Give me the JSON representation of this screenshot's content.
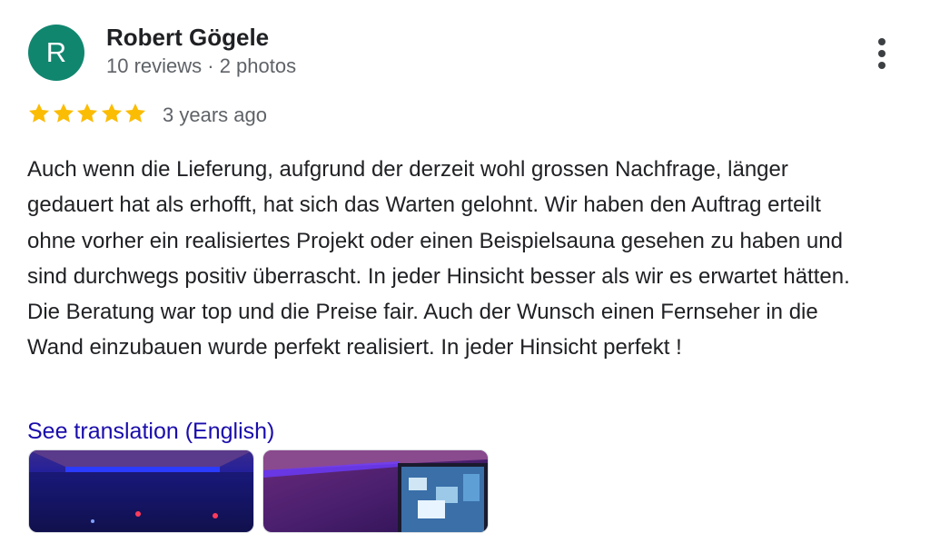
{
  "author": {
    "avatar_letter": "R",
    "avatar_color": "#11866f",
    "name": "Robert Gögele",
    "meta": "10 reviews · 2 photos"
  },
  "menu": {
    "icon": "more-vert-icon"
  },
  "rating": {
    "stars": 5,
    "max_stars": 5,
    "star_color": "#fbbc04",
    "time": "3 years ago"
  },
  "review": {
    "text": "Auch wenn die Lieferung, aufgrund der derzeit wohl grossen Nachfrage, länger gedauert hat als erhofft, hat sich das Warten gelohnt. Wir haben den Auftrag erteilt ohne vorher ein realisiertes Projekt oder einen Beispielsauna gesehen zu haben und sind durchwegs positiv überrascht. In jeder Hinsicht besser als wir es erwartet hätten. Die Beratung war top und die Preise fair. Auch der Wunsch einen Fernseher in die Wand einzubauen wurde perfekt realisiert. In jeder Hinsicht perfekt !",
    "translate_label": "See translation (English)",
    "link_color": "#1a0dab"
  },
  "photos": [
    {
      "subject": "sauna interior with blue ceiling lighting"
    },
    {
      "subject": "sauna interior with purple lighting and wall-mounted TV"
    }
  ]
}
